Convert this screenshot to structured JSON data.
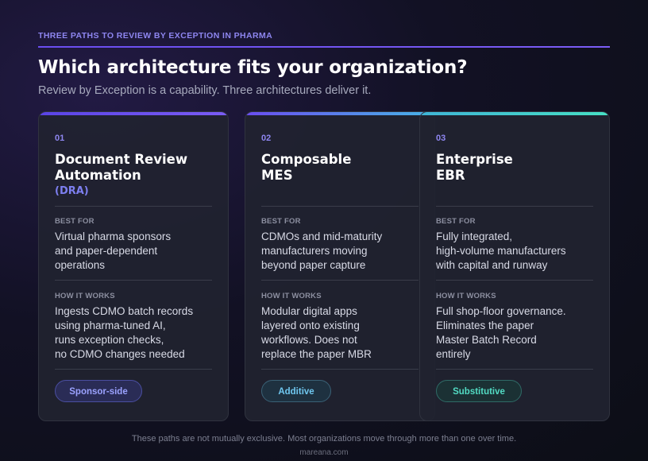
{
  "header": {
    "eyebrow": "THREE PATHS TO REVIEW BY EXCEPTION IN PHARMA",
    "title": "Which architecture fits your organization?",
    "subtitle": "Review by Exception is a capability. Three architectures deliver it."
  },
  "labels": {
    "best_for": "BEST FOR",
    "how_it_works": "HOW IT WORKS"
  },
  "cards": [
    {
      "number": "01",
      "title_lines": [
        "Document Review",
        "Automation"
      ],
      "abbr": "(DRA)",
      "best_for_lines": [
        "Virtual pharma sponsors",
        "and paper-dependent",
        "operations"
      ],
      "how_lines": [
        "Ingests CDMO batch records",
        "using pharma-tuned AI,",
        "runs exception checks,",
        "no CDMO changes needed"
      ],
      "tag": "Sponsor-side",
      "accent": "#7a5cf5"
    },
    {
      "number": "02",
      "title_lines": [
        "Composable",
        "MES"
      ],
      "best_for_lines": [
        "CDMOs and mid-maturity",
        "manufacturers moving",
        "beyond paper capture"
      ],
      "how_lines": [
        "Modular digital apps",
        "layered onto existing",
        "workflows. Does not",
        "replace the paper MBR"
      ],
      "tag": "Additive",
      "accent": "#47b5e6"
    },
    {
      "number": "03",
      "title_lines": [
        "Enterprise",
        "EBR"
      ],
      "best_for_lines": [
        "Fully integrated,",
        "high-volume manufacturers",
        "with capital and runway"
      ],
      "how_lines": [
        "Full shop-floor governance.",
        "Eliminates the paper",
        "Master Batch Record",
        "entirely"
      ],
      "tag": "Substitutive",
      "accent": "#46e0c4"
    }
  ],
  "footer": {
    "note": "These paths are not mutually exclusive. Most organizations move through more than one over time.",
    "url": "mareana.com"
  }
}
